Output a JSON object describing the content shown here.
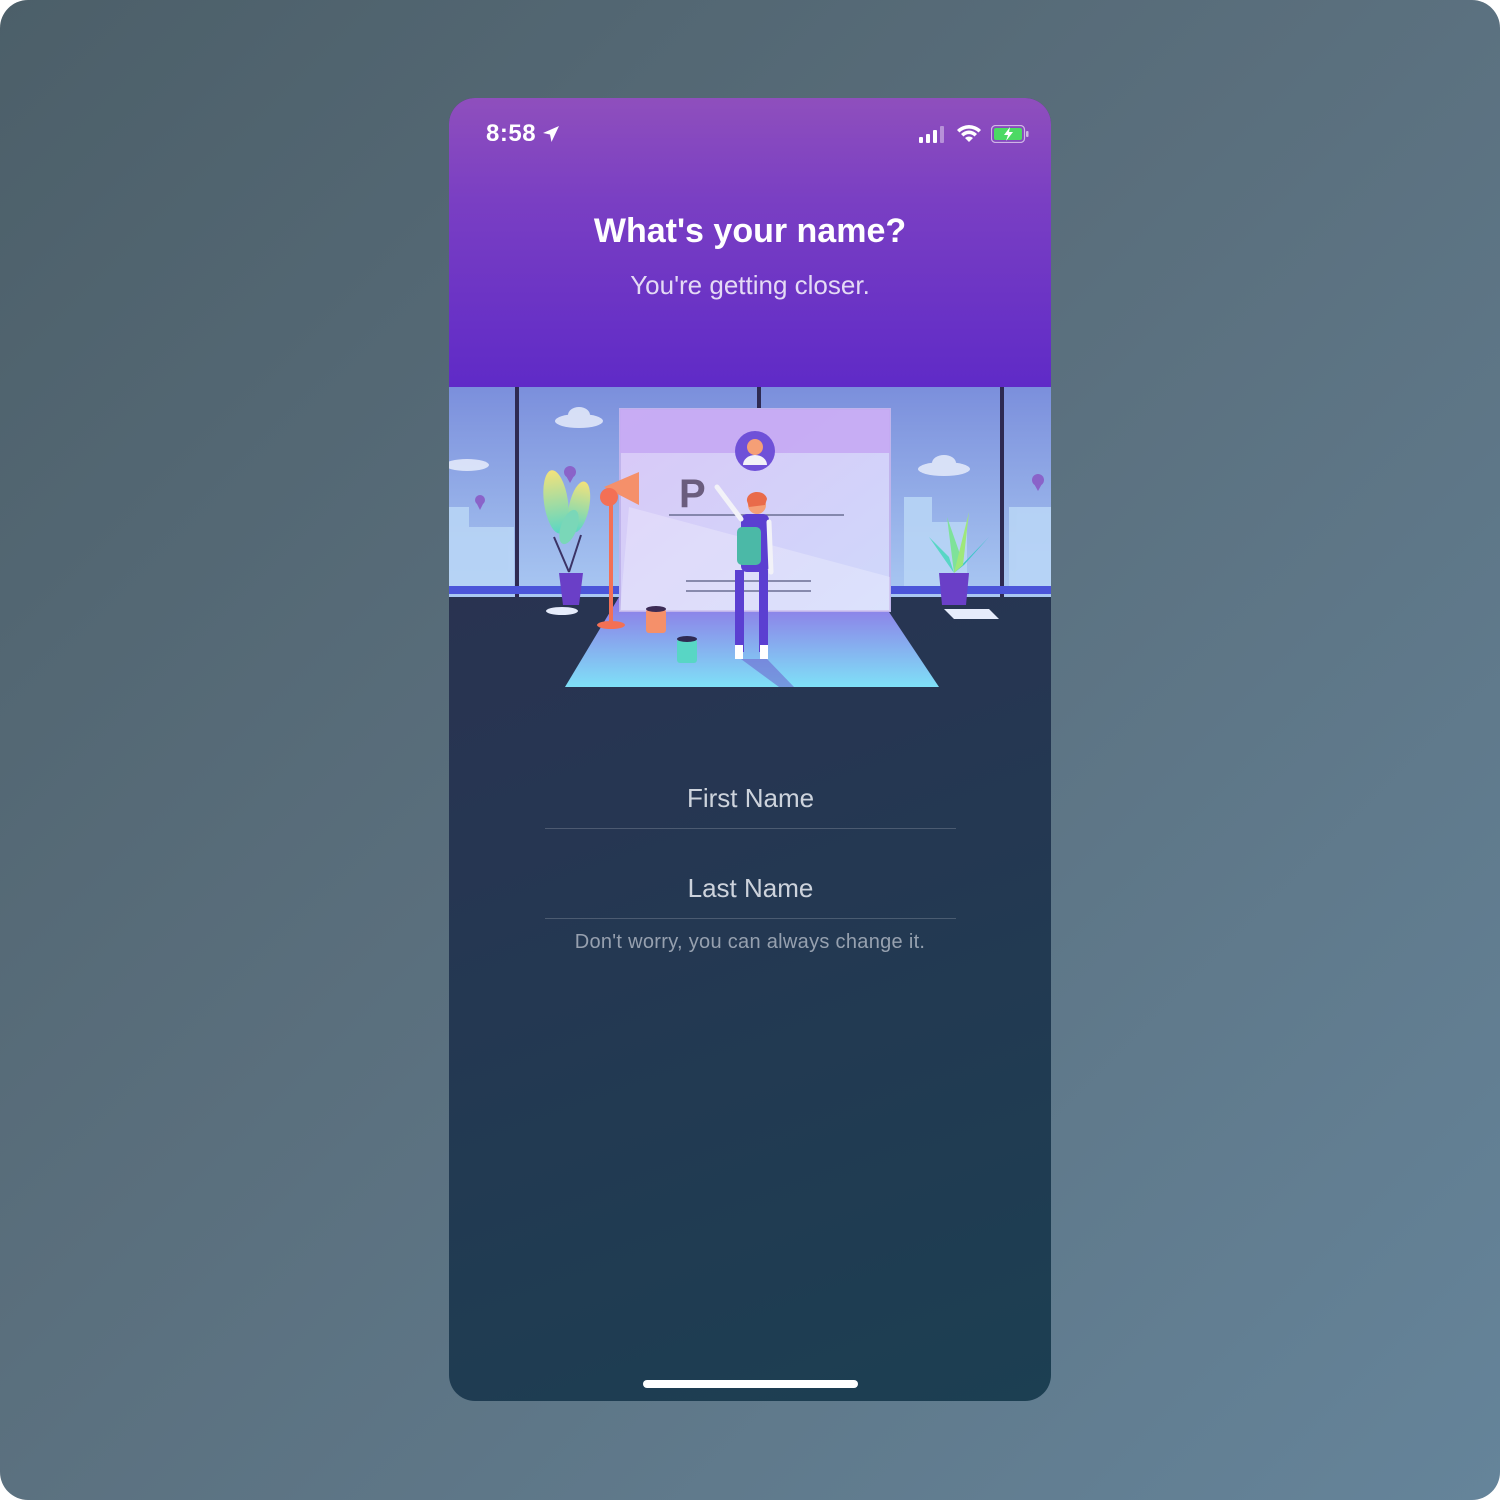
{
  "status_bar": {
    "time": "8:58",
    "icons": [
      "location-arrow-icon",
      "cellular-signal-icon",
      "wifi-icon",
      "battery-charging-icon"
    ]
  },
  "header": {
    "title": "What's your name?",
    "subtitle": "You're getting closer."
  },
  "illustration": {
    "logo_glyph": "P"
  },
  "form": {
    "first_name_placeholder": "First Name",
    "last_name_placeholder": "Last Name",
    "hint": "Don't worry, you can always change it."
  },
  "colors": {
    "header_top": "#8f4fbd",
    "header_bottom": "#5f2ac7",
    "background_dark": "#263652"
  }
}
